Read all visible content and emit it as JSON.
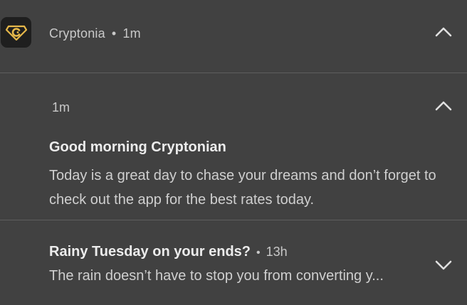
{
  "app": {
    "name": "Cryptonia",
    "separator": "•",
    "time": "1m",
    "expand_icon": "chevron-up-icon",
    "logo_icon": "cryptonia-logo-icon"
  },
  "notifications": [
    {
      "time": "1m",
      "title": "Good morning Cryptonian",
      "body": "Today is a great day to chase your dreams and don’t forget to check out the app for the best rates today.",
      "toggle_icon": "chevron-up-icon"
    },
    {
      "title": "Rainy Tuesday on your ends?",
      "separator": "•",
      "time": "13h",
      "body": "The rain doesn’t have to stop you from converting y...",
      "toggle_icon": "chevron-down-icon"
    }
  ],
  "colors": {
    "background": "#414141",
    "divider": "#5e5e5e",
    "icon_bg": "#1f1f1f",
    "logo_gold": "#e6b84a"
  }
}
